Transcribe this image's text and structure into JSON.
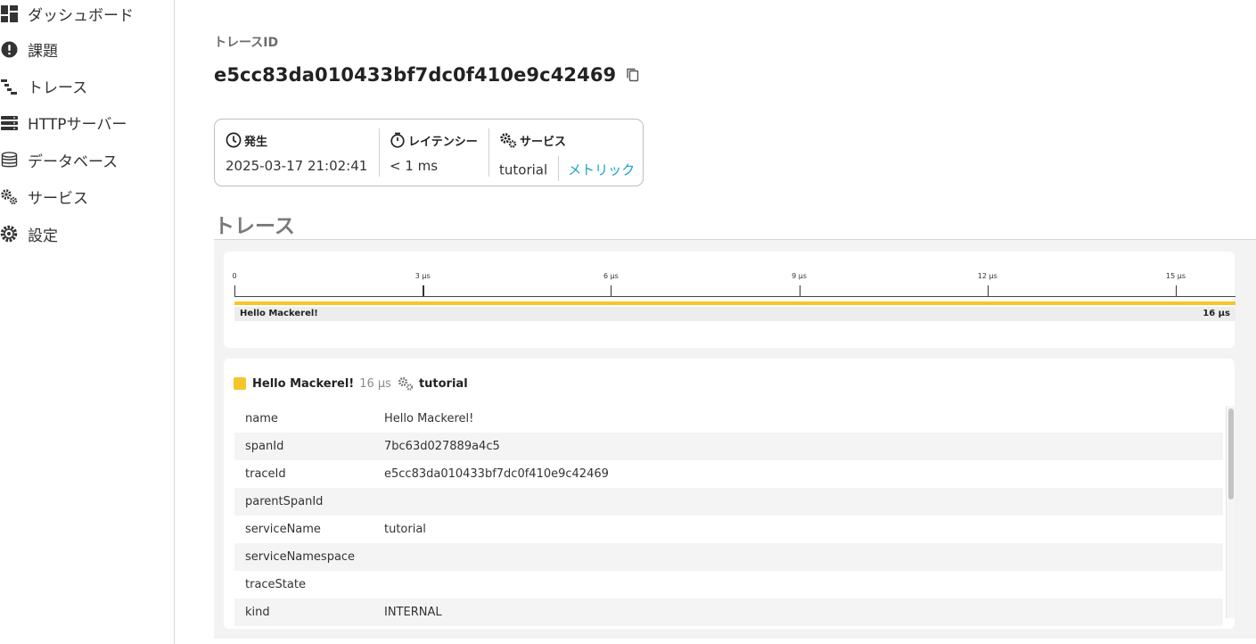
{
  "sidebar": {
    "items": [
      {
        "label": "ダッシュボード",
        "icon": "dashboard-icon"
      },
      {
        "label": "課題",
        "icon": "alert-icon"
      },
      {
        "label": "トレース",
        "icon": "trace-icon"
      },
      {
        "label": "HTTPサーバー",
        "icon": "server-icon"
      },
      {
        "label": "データベース",
        "icon": "database-icon"
      },
      {
        "label": "サービス",
        "icon": "gears-icon"
      },
      {
        "label": "設定",
        "icon": "settings-icon"
      }
    ]
  },
  "header": {
    "trace_id_label": "トレースID",
    "trace_id": "e5cc83da010433bf7dc0f410e9c42469"
  },
  "info": {
    "occurred_label": "発生",
    "occurred_value": "2025-03-17 21:02:41",
    "latency_label": "レイテンシー",
    "latency_value": "< 1 ms",
    "service_label": "サービス",
    "service_value": "tutorial",
    "metric_link": "メトリック"
  },
  "section_title": "トレース",
  "timeline": {
    "ticks": [
      "0",
      "3 µs",
      "6 µs",
      "9 µs",
      "12 µs",
      "15 µs"
    ],
    "span_name": "Hello Mackerel!",
    "span_duration": "16 µs"
  },
  "detail": {
    "span_name": "Hello Mackerel!",
    "duration": "16 µs",
    "service": "tutorial",
    "attributes": [
      {
        "k": "name",
        "v": "Hello Mackerel!"
      },
      {
        "k": "spanId",
        "v": "7bc63d027889a4c5"
      },
      {
        "k": "traceId",
        "v": "e5cc83da010433bf7dc0f410e9c42469"
      },
      {
        "k": "parentSpanId",
        "v": ""
      },
      {
        "k": "serviceName",
        "v": "tutorial"
      },
      {
        "k": "serviceNamespace",
        "v": ""
      },
      {
        "k": "traceState",
        "v": ""
      },
      {
        "k": "kind",
        "v": "INTERNAL"
      }
    ]
  },
  "colors": {
    "accent": "#f5c52a",
    "link": "#1aa3c9"
  }
}
